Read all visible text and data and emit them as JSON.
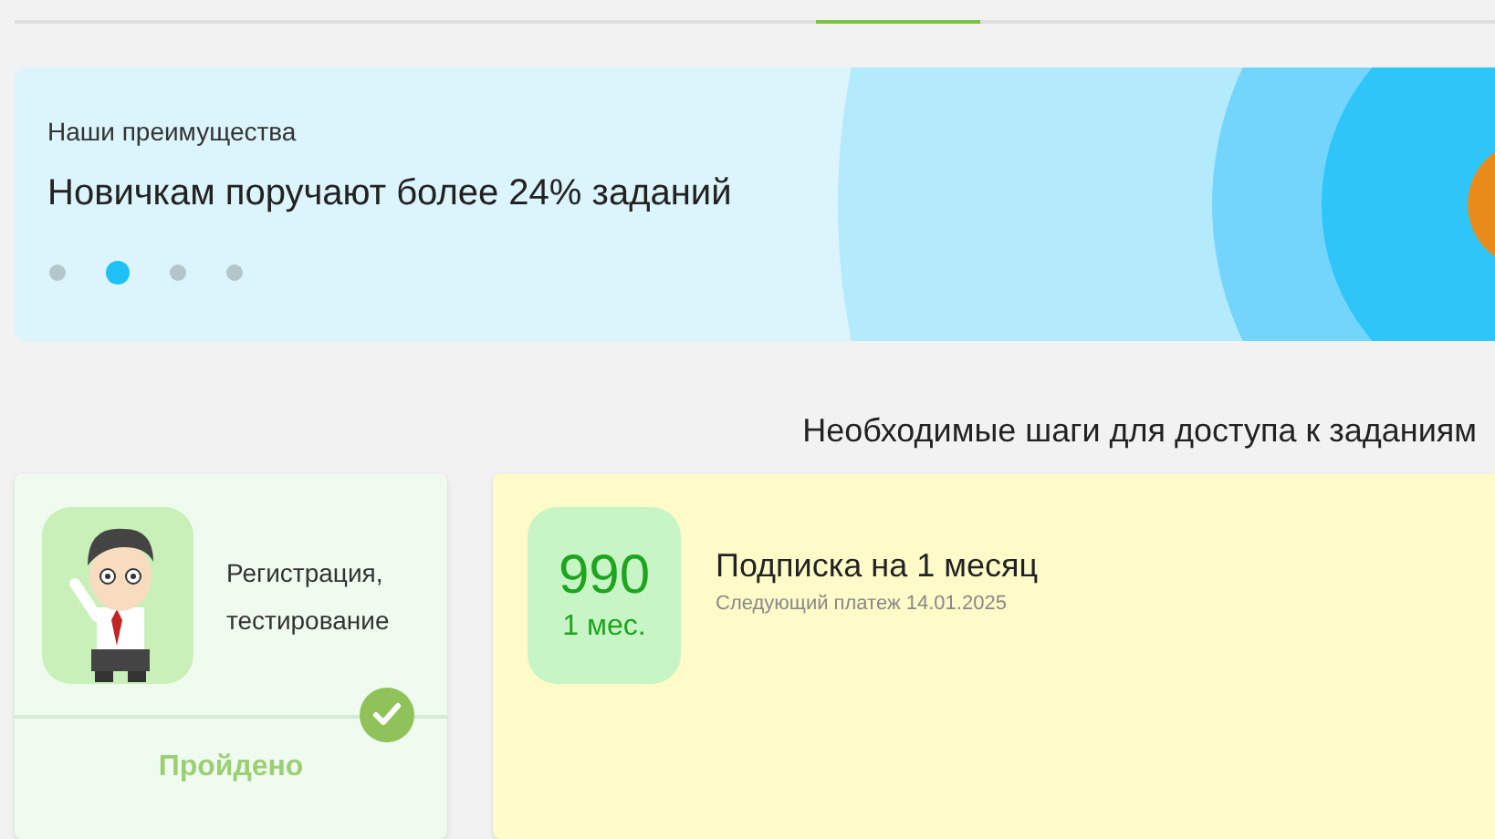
{
  "banner": {
    "caption": "Наши преимущества",
    "headline": "Новичкам поручают более 24% заданий",
    "dots": [
      {
        "selected": false
      },
      {
        "selected": true
      },
      {
        "selected": false
      },
      {
        "selected": false
      }
    ]
  },
  "steps_heading": "Необходимые шаги для доступа к заданиям",
  "step": {
    "label_lines": [
      "Регистрация,",
      "тестирование"
    ],
    "completed": true,
    "status": "Пройдено"
  },
  "subscription": {
    "price": "990",
    "period": "1 мес.",
    "title": "Подписка на 1 месяц",
    "next_payment": "Следующий платеж 14.01.2025"
  }
}
